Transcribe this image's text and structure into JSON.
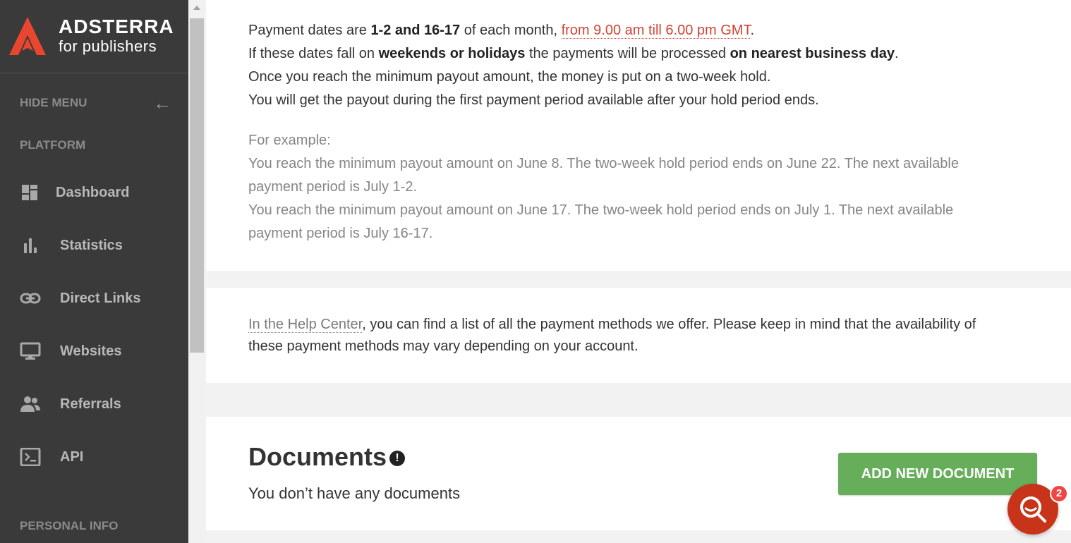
{
  "brand": {
    "name": "ADSTERRA",
    "tagline": "for publishers",
    "accent": "#e8462e"
  },
  "sidebar": {
    "hide_menu_label": "HIDE MENU",
    "platform_label": "PLATFORM",
    "personal_info_label": "PERSONAL INFO",
    "items": [
      {
        "label": "Dashboard",
        "icon": "dashboard-icon"
      },
      {
        "label": "Statistics",
        "icon": "bar-chart-icon"
      },
      {
        "label": "Direct Links",
        "icon": "link-icon"
      },
      {
        "label": "Websites",
        "icon": "monitor-icon"
      },
      {
        "label": "Referrals",
        "icon": "users-icon"
      },
      {
        "label": "API",
        "icon": "terminal-icon"
      }
    ]
  },
  "payment_info": {
    "line1_prefix": "Payment dates are ",
    "line1_dates": "1-2 and 16-17",
    "line1_mid": " of each month, ",
    "line1_time": "from 9.00 am till 6.00 pm GMT",
    "line1_end": ".",
    "line2_prefix": "If these dates fall on ",
    "line2_bold1": "weekends or holidays",
    "line2_mid": " the payments will be processed ",
    "line2_bold2": "on nearest business day",
    "line2_end": ".",
    "line3": "Once you reach the minimum payout amount, the money is put on a two-week hold.",
    "line4": "You will get the payout during the first payment period available after your hold period ends.",
    "example_title": "For example:",
    "example1_a": "You reach the minimum payout amount on June 8. The two-week hold period ends on June 22. The next available",
    "example1_b": "payment period is July 1-2.",
    "example2_a": "You reach the minimum payout amount on June 17. The two-week hold period ends on July 1. The next available",
    "example2_b": "payment period is July 16-17."
  },
  "payment_methods": {
    "link_text": "In the Help Center",
    "text_a": ", you can find a list of all the payment methods we offer. Please keep in mind that the availability of",
    "text_b": "these payment methods may vary depending on your account."
  },
  "documents": {
    "title": "Documents",
    "info_glyph": "!",
    "empty_text": "You don’t have any documents",
    "add_button": "ADD NEW DOCUMENT",
    "button_color": "#67ae5b"
  },
  "chat": {
    "badge_count": "2",
    "color": "#c83419"
  }
}
